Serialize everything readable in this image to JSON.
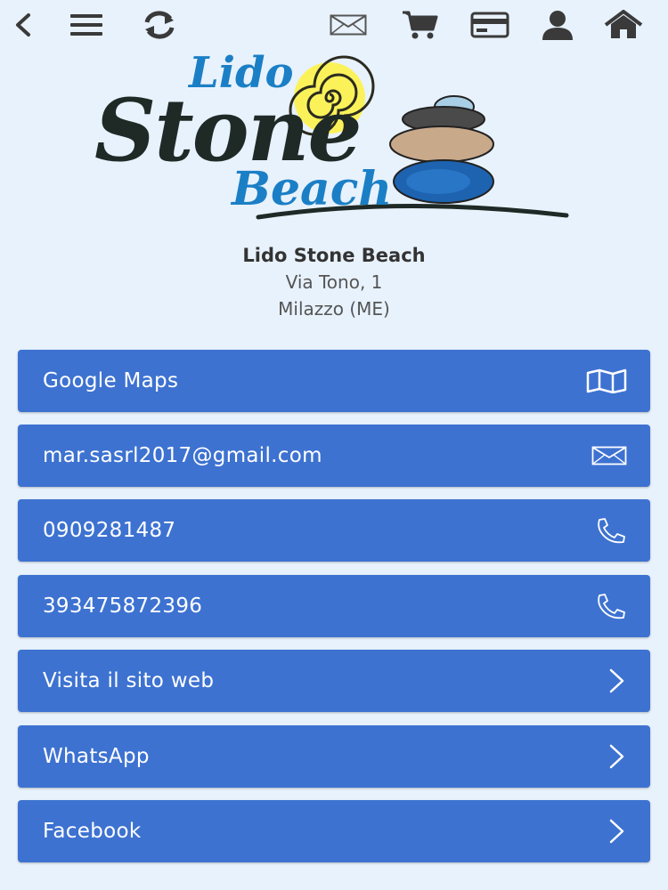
{
  "toolbar": {
    "icons": [
      "back-icon",
      "menu-icon",
      "refresh-icon",
      "mail-icon",
      "cart-icon",
      "credit-card-icon",
      "user-icon",
      "home-icon"
    ]
  },
  "logo": {
    "line1": "Lido",
    "line2": "Stone",
    "line3": "Beach",
    "colors": {
      "blue": "#1b7fc6",
      "dark": "#1f2a27",
      "sun": "#f0e000"
    }
  },
  "business": {
    "name": "Lido Stone Beach",
    "address": "Via Tono, 1",
    "city": "Milazzo (ME)"
  },
  "buttons": [
    {
      "label": "Google Maps",
      "icon": "map-icon"
    },
    {
      "label": "mar.sasrl2017@gmail.com",
      "icon": "envelope-icon"
    },
    {
      "label": "0909281487",
      "icon": "phone-icon"
    },
    {
      "label": "393475872396",
      "icon": "phone-icon"
    },
    {
      "label": "Visita il sito web",
      "icon": "chevron-right-icon"
    },
    {
      "label": "WhatsApp",
      "icon": "chevron-right-icon"
    },
    {
      "label": "Facebook",
      "icon": "chevron-right-icon"
    }
  ],
  "colors": {
    "background": "#e8f2fc",
    "button": "#3d72d1",
    "icon": "#3a3a3a"
  }
}
